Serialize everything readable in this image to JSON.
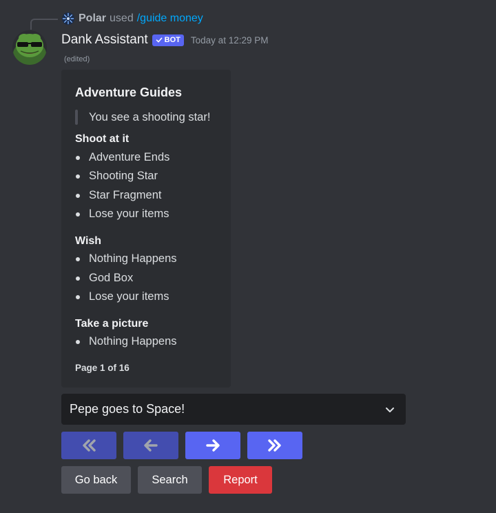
{
  "reply": {
    "user": "Polar",
    "used_text": "used",
    "command": "/guide money"
  },
  "message": {
    "username": "Dank Assistant",
    "bot_tag": "BOT",
    "timestamp": "Today at 12:29 PM",
    "edited": "(edited)"
  },
  "embed": {
    "title": "Adventure Guides",
    "quote": "You see a shooting star!",
    "sections": [
      {
        "title": "Shoot at it",
        "items": [
          "Adventure Ends",
          "Shooting Star",
          "Star Fragment",
          "Lose your items"
        ]
      },
      {
        "title": "Wish",
        "items": [
          "Nothing Happens",
          "God Box",
          "Lose your items"
        ]
      },
      {
        "title": "Take a picture",
        "items": [
          "Nothing Happens"
        ]
      }
    ],
    "footer": "Page 1 of 16"
  },
  "select": {
    "value": "Pepe goes to Space!",
    "icon": "chevron-down-icon"
  },
  "nav_buttons": [
    {
      "icon": "double-left-icon",
      "disabled": true
    },
    {
      "icon": "arrow-left-icon",
      "disabled": true
    },
    {
      "icon": "arrow-right-icon",
      "disabled": false
    },
    {
      "icon": "double-right-icon",
      "disabled": false
    }
  ],
  "actions": {
    "go_back": "Go back",
    "search": "Search",
    "report": "Report"
  },
  "colors": {
    "background": "#313338",
    "embed": "#2b2d31",
    "blurple": "#5865f2",
    "danger": "#da373c",
    "secondary": "#4e5058",
    "link": "#00a8fc"
  }
}
